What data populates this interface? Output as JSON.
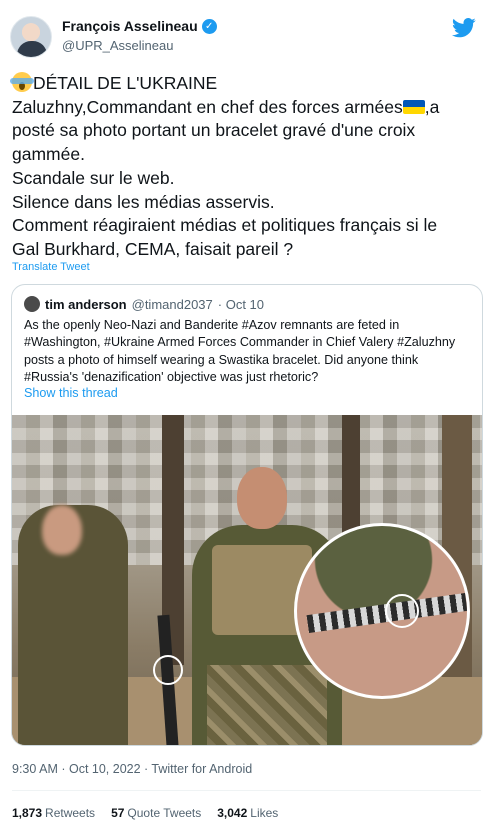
{
  "author": {
    "display_name": "François Asselineau",
    "handle": "@UPR_Asselineau",
    "verified_icon": "verified-badge-icon"
  },
  "tweet": {
    "lines": [
      "DÉTAIL DE L'UKRAINE",
      "Zaluzhny,Commandant en chef des forces armées",
      ",a",
      "posté sa photo portant un bracelet gravé d'une croix",
      "gammée.",
      "Scandale sur le web.",
      "Silence dans les médias asservis.",
      "Comment réagiraient médias et politiques français si le",
      "Gal Burkhard, CEMA, faisait pareil ?"
    ],
    "emoji_start": "face-screaming-in-fear",
    "emoji_flag": "flag-ukraine",
    "translate_label": "Translate Tweet"
  },
  "quote": {
    "name": "tim anderson",
    "handle": "@timand2037",
    "date": "· Oct 10",
    "lines": [
      "As the openly Neo-Nazi and Banderite #Azov remnants are feted in",
      "#Washington, #Ukraine Armed Forces Commander in Chief Valery #Zaluzhny",
      "posts a photo of himself wearing a Swastika bracelet. Did anyone think",
      "#Russia's 'denazification' objective was just rhetoric?"
    ],
    "show_thread": "Show this thread"
  },
  "meta": {
    "timestamp": "9:30 AM · Oct 10, 2022 · Twitter for Android"
  },
  "stats": {
    "retweets_count": "1,873",
    "retweets_label": "Retweets",
    "quotes_count": "57",
    "quotes_label": "Quote Tweets",
    "likes_count": "3,042",
    "likes_label": "Likes"
  },
  "colors": {
    "link": "#1d9bf0",
    "muted": "#536471",
    "text": "#0f1419",
    "flag_blue": "#0057b7",
    "flag_yellow": "#ffd700"
  }
}
